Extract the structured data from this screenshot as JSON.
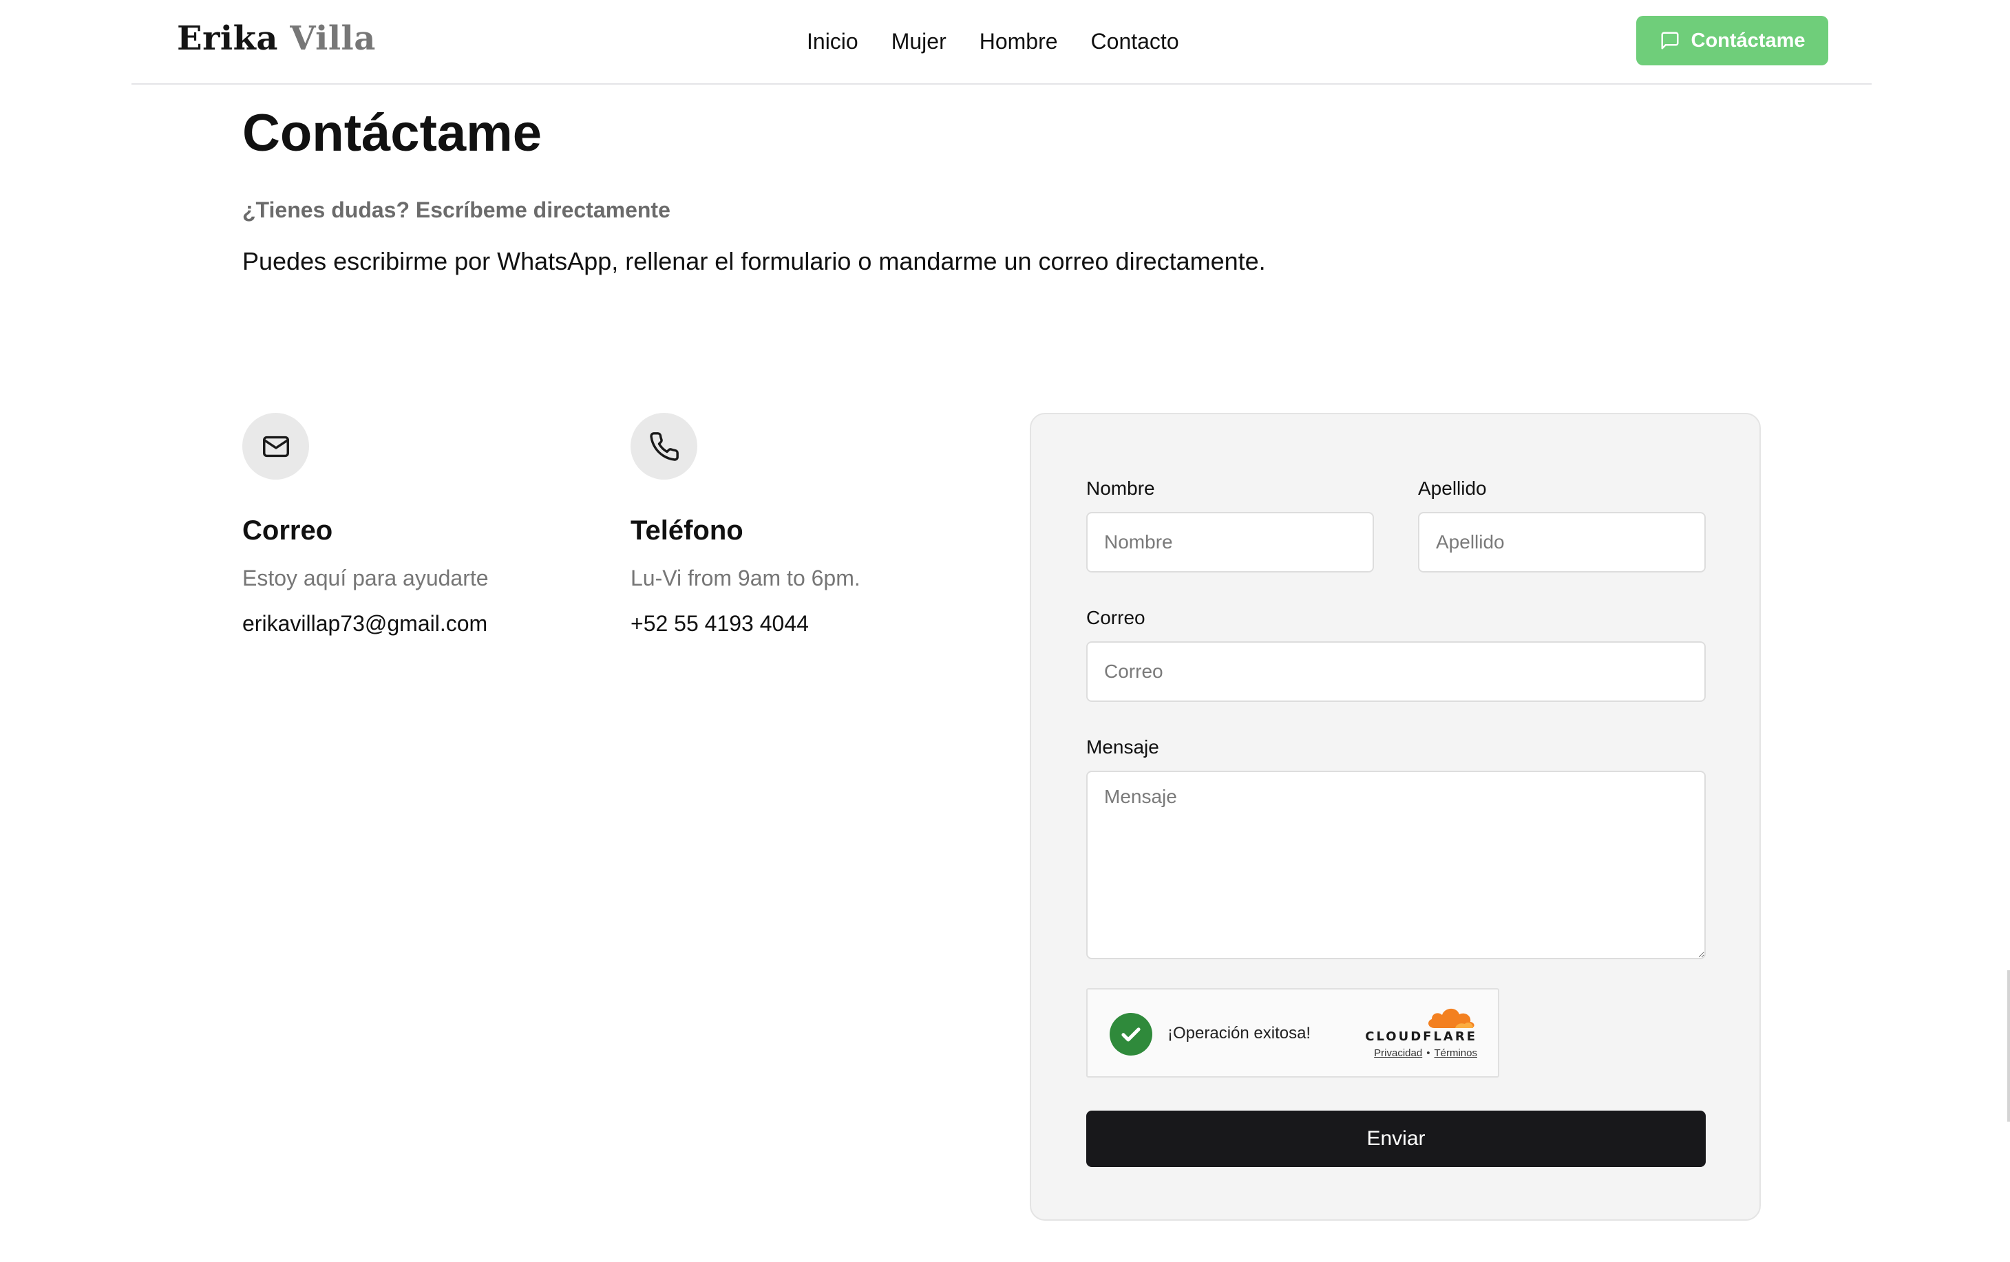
{
  "header": {
    "logo_first": "Erika",
    "logo_last": "Villa",
    "nav": [
      "Inicio",
      "Mujer",
      "Hombre",
      "Contacto"
    ],
    "cta_label": "Contáctame",
    "cta_color": "#6fce7a"
  },
  "intro": {
    "title": "Contáctame",
    "subtitle": "¿Tienes dudas? Escríbeme directamente",
    "text": "Puedes escribirme por WhatsApp, rellenar el formulario o mandarme un correo directamente."
  },
  "contact_email": {
    "icon": "mail-icon",
    "title": "Correo",
    "description": "Estoy aquí para ayudarte",
    "value": "erikavillap73@gmail.com"
  },
  "contact_phone": {
    "icon": "phone-icon",
    "title": "Teléfono",
    "description": "Lu-Vi from 9am to 6pm.",
    "value": "+52 55 4193 4044"
  },
  "form": {
    "first_name_label": "Nombre",
    "first_name_placeholder": "Nombre",
    "last_name_label": "Apellido",
    "last_name_placeholder": "Apellido",
    "email_label": "Correo",
    "email_placeholder": "Correo",
    "message_label": "Mensaje",
    "message_placeholder": "Mensaje",
    "submit_label": "Enviar"
  },
  "captcha": {
    "status": "¡Operación exitosa!",
    "brand": "CLOUDFLARE",
    "privacy_link": "Privacidad",
    "separator": "•",
    "terms_link": "Términos",
    "success_color": "#2f8a3b",
    "brand_color": "#f38020"
  }
}
